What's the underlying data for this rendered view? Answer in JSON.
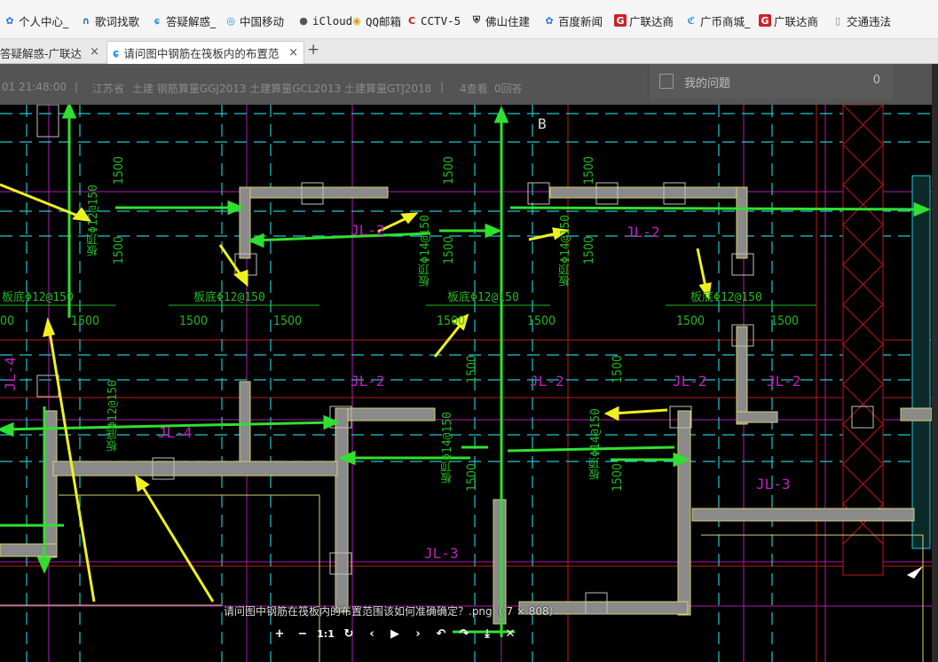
{
  "bookmarks": [
    {
      "label": "个人中心_",
      "icon": "paw-icon",
      "color": "#2a78d6"
    },
    {
      "label": "歌词找歌",
      "icon": "headphones-icon",
      "color": "#1f70d0"
    },
    {
      "label": "答疑解惑_",
      "icon": "glodon-icon",
      "color": "#1f8fe0"
    },
    {
      "label": "中国移动",
      "icon": "china-mobile-icon",
      "color": "#1f8fe0"
    },
    {
      "label": "iCloud",
      "icon": "apple-icon",
      "color": "#555555"
    },
    {
      "label": "QQ邮箱",
      "icon": "qq-mail-icon",
      "color": "#e0a000"
    },
    {
      "label": "CCTV-5",
      "icon": "cctv-icon",
      "color": "#c81e1e"
    },
    {
      "label": "佛山住建",
      "icon": "shield-icon",
      "color": "#333333"
    },
    {
      "label": "百度新闻",
      "icon": "baidu-icon",
      "color": "#2a78d6"
    },
    {
      "label": "广联达商",
      "icon": "glodon-g-icon",
      "color": "#d0202a"
    },
    {
      "label": "广币商城_",
      "icon": "guangbi-icon",
      "color": "#1f8fe0"
    },
    {
      "label": "广联达商",
      "icon": "glodon-g-icon",
      "color": "#d0202a"
    },
    {
      "label": "交通违法",
      "icon": "document-icon",
      "color": "#888888"
    }
  ],
  "tabs": [
    {
      "label": "答疑解惑-广联达",
      "active": false
    },
    {
      "label": "请问图中钢筋在筏板内的布置范",
      "active": true
    }
  ],
  "tab_close": "×",
  "new_tab": "+",
  "infobar": {
    "time": "01 21:48:00",
    "sep": "|",
    "location": "江苏省",
    "tags": "土建 钢筋算量GGJ2013 土建算量GCL2013 土建算量GTJ2018",
    "views": "4查看",
    "answers": "0回答"
  },
  "question_panel": {
    "label": "我的问题",
    "count": "0"
  },
  "cad": {
    "grid_label": "B",
    "jl_labels": [
      "JL-2",
      "JL-2",
      "JL-2",
      "JL-2",
      "JL-2",
      "JL-2",
      "JL-4",
      "JL-4",
      "JL-3",
      "JL-3"
    ],
    "rebar_labels": [
      "板底Φ12@150",
      "板底Φ12@150",
      "板底Φ12@150",
      "板底Φ12@150",
      "板顶Φ12@150",
      "板顶Φ14@150",
      "板顶Φ14@150",
      "板底Φ12@150",
      "板顶Φ14@150",
      "板顶Φ14@150"
    ],
    "dim_1500": "1500",
    "dim_00": "00"
  },
  "image_caption": "请问图中钢筋在筏板内的布置范围该如何准确确定？.png（   7 × 808）",
  "viewer_tools": [
    {
      "name": "zoom-in-icon",
      "glyph": "+"
    },
    {
      "name": "zoom-out-icon",
      "glyph": "−"
    },
    {
      "name": "actual-size-icon",
      "glyph": "1:1"
    },
    {
      "name": "rotate-icon",
      "glyph": "↻"
    },
    {
      "name": "prev-icon",
      "glyph": "‹"
    },
    {
      "name": "play-icon",
      "glyph": "▶"
    },
    {
      "name": "next-icon",
      "glyph": "›"
    },
    {
      "name": "undo-icon",
      "glyph": "↶"
    },
    {
      "name": "redo-icon",
      "glyph": "↷"
    },
    {
      "name": "download-icon",
      "glyph": "⤓"
    },
    {
      "name": "close-viewer-icon",
      "glyph": "✕"
    }
  ]
}
